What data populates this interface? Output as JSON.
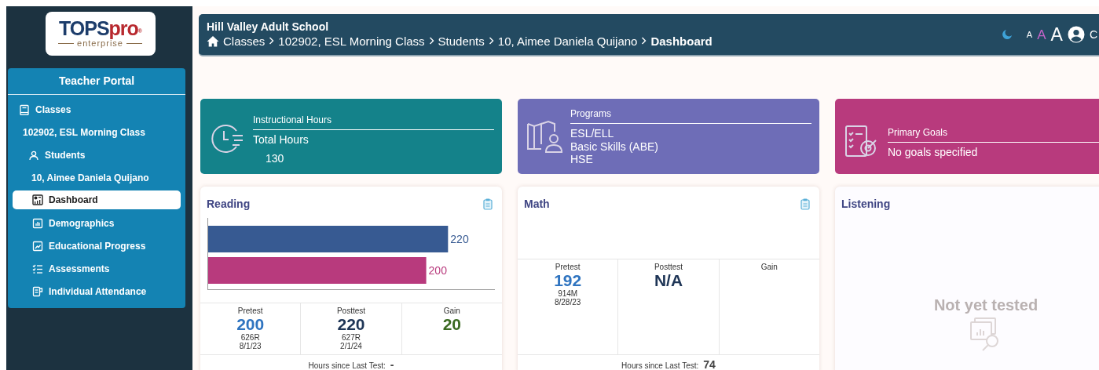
{
  "sidebar": {
    "logo": {
      "brand_main": "TOPS",
      "brand_suffix": "pro",
      "registered": "®",
      "tagline": "enterprise"
    },
    "portal_title": "Teacher Portal",
    "items": [
      {
        "label": "Classes",
        "selected": false,
        "children": [
          {
            "label": "102902, ESL Morning Class",
            "selected": false,
            "children": [
              {
                "label": "Students",
                "selected": false,
                "children": [
                  {
                    "label": "10, Aimee Daniela Quijano",
                    "selected": false,
                    "children": [
                      {
                        "label": "Dashboard",
                        "selected": true
                      },
                      {
                        "label": "Demographics",
                        "selected": false
                      },
                      {
                        "label": "Educational Progress",
                        "selected": false
                      },
                      {
                        "label": "Assessments",
                        "selected": false
                      },
                      {
                        "label": "Individual Attendance",
                        "selected": false
                      }
                    ]
                  }
                ]
              }
            ]
          }
        ]
      }
    ]
  },
  "header": {
    "school": "Hill Valley Adult School",
    "breadcrumb": [
      {
        "label": "Classes",
        "current": false
      },
      {
        "label": "102902, ESL Morning Class",
        "current": false
      },
      {
        "label": "Students",
        "current": false
      },
      {
        "label": "10, Aimee Daniela Quijano",
        "current": false
      },
      {
        "label": "Dashboard",
        "current": true
      }
    ],
    "font_sizes": [
      {
        "label": "A",
        "selected": false
      },
      {
        "label": "A",
        "selected": true
      },
      {
        "label": "A",
        "selected": false
      }
    ],
    "user_name": "C"
  },
  "summary_cards": [
    {
      "kind": "hours",
      "title": "Instructional Hours",
      "label": "Total Hours",
      "value": "130"
    },
    {
      "kind": "list",
      "title": "Programs",
      "items": [
        "ESL/ELL",
        "Basic Skills (ABE)",
        "HSE"
      ]
    },
    {
      "kind": "text",
      "title": "Primary Goals",
      "text": "No goals specified"
    }
  ],
  "subject_cards": [
    {
      "kind": "scores",
      "title": "Reading",
      "chart_data": {
        "type": "bar",
        "orientation": "horizontal",
        "xlim": [
          0,
          263
        ],
        "data_labels": true,
        "series": [
          {
            "color": "#375a92",
            "values": [
              220
            ]
          },
          {
            "color": "#b83a7d",
            "values": [
              200
            ]
          }
        ]
      },
      "pretest": {
        "label": "Pretest",
        "score": "200",
        "scale": "626R",
        "date": "8/1/23"
      },
      "posttest": {
        "label": "Posttest",
        "score": "220",
        "scale": "627R",
        "date": "2/1/24"
      },
      "gain": {
        "label": "Gain",
        "score": "20"
      },
      "hours_label": "Hours since Last Test:",
      "hours_value": "-"
    },
    {
      "kind": "scores",
      "title": "Math",
      "pretest": {
        "label": "Pretest",
        "score": "192",
        "scale": "914M",
        "date": "8/28/23"
      },
      "posttest": {
        "label": "Posttest",
        "score": "N/A"
      },
      "gain": {
        "label": "Gain"
      },
      "hours_label": "Hours since Last Test:",
      "hours_value": "74"
    },
    {
      "kind": "untested",
      "title": "Listening",
      "message": "Not yet tested"
    }
  ]
}
